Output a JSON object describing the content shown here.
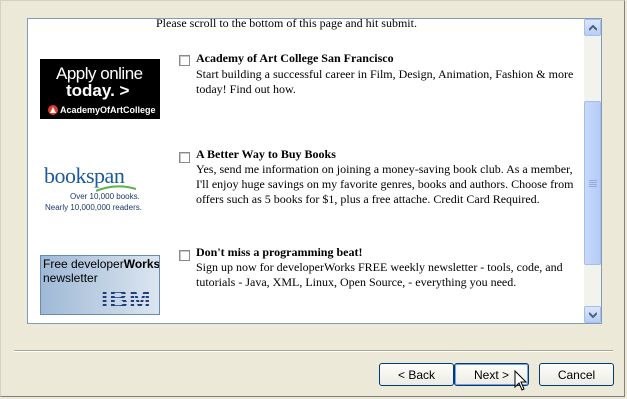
{
  "intro": "Please scroll to the bottom of this page and hit submit.",
  "offers": [
    {
      "title": "Academy of Art College San Francisco",
      "description": "Start building a successful career in Film, Design, Animation, Fashion & more today! Find out how.",
      "logo": {
        "line1": "Apply online",
        "line2": "today. >",
        "line3": "AcademyOfArtCollege"
      }
    },
    {
      "title": "A Better Way to Buy Books",
      "description": "Yes, send me information on joining a money-saving book club. As a member, I'll enjoy huge savings on my favorite genres, books and authors. Choose from offers such as 5 books for $1, plus a free attache. Credit Card Required.",
      "logo": {
        "brand": "bookspan",
        "line1": "Over 10,000 books.",
        "line2": "Nearly 10,000,000 readers."
      }
    },
    {
      "title": "Don't miss a programming beat!",
      "description": "Sign up now for developerWorks FREE weekly newsletter - tools, code, and tutorials - Java, XML, Linux, Open Source, - everything you need.",
      "logo": {
        "line1a": "Free developer",
        "line1b": "Works",
        "line2": "newsletter",
        "brand": "IBM"
      }
    }
  ],
  "buttons": {
    "back": "< Back",
    "next": "Next >",
    "cancel": "Cancel"
  },
  "colors": {
    "background": "#ece9d8",
    "panel_border": "#7f9db9",
    "scroll_thumb": "#b5ccf7",
    "button_border": "#003c74"
  }
}
